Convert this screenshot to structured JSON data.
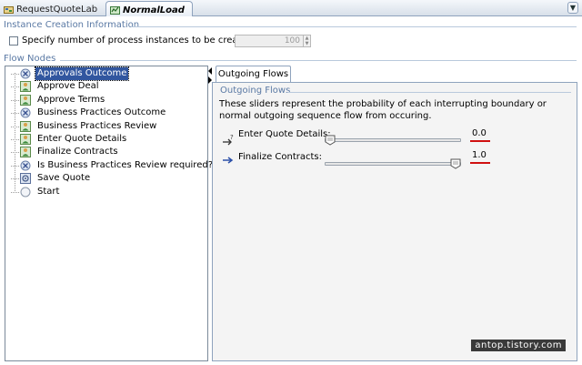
{
  "editor_tabs": [
    {
      "label": "RequestQuoteLab",
      "active": false
    },
    {
      "label": "NormalLoad",
      "active": true
    }
  ],
  "instance_creation": {
    "title": "Instance Creation Information",
    "checkbox_label": "Specify number of process instances to be created",
    "checked": false,
    "count_value": "100"
  },
  "flow_nodes": {
    "title": "Flow Nodes",
    "items": [
      {
        "label": "Approvals Outcome",
        "icon": "gateway-icon",
        "selected": true
      },
      {
        "label": "Approve Deal",
        "icon": "user-task-icon",
        "selected": false
      },
      {
        "label": "Approve Terms",
        "icon": "user-task-icon",
        "selected": false
      },
      {
        "label": "Business Practices Outcome",
        "icon": "gateway-icon",
        "selected": false
      },
      {
        "label": "Business Practices Review",
        "icon": "user-task-icon",
        "selected": false
      },
      {
        "label": "Enter Quote Details",
        "icon": "user-task-icon",
        "selected": false
      },
      {
        "label": "Finalize Contracts",
        "icon": "user-task-icon",
        "selected": false
      },
      {
        "label": "Is Business Practices Review required?",
        "icon": "gateway-icon",
        "selected": false
      },
      {
        "label": "Save Quote",
        "icon": "service-task-icon",
        "selected": false
      },
      {
        "label": "Start",
        "icon": "start-event-icon",
        "selected": false
      }
    ]
  },
  "outgoing": {
    "tab_label": "Outgoing Flows",
    "section_title": "Outgoing Flows",
    "description": "These sliders represent the probability of each interrupting boundary or normal outgoing sequence flow from occuring.",
    "flows": [
      {
        "label": "Enter Quote Details:",
        "value_text": "0.0",
        "probability": 0.0,
        "icon": "conditional-flow-icon"
      },
      {
        "label": "Finalize Contracts:",
        "value_text": "1.0",
        "probability": 1.0,
        "icon": "default-flow-icon"
      }
    ]
  },
  "watermark": "antop.tistory.com",
  "colors": {
    "selection": "#31569f",
    "section_title": "#5a79a4",
    "underline": "#d01010"
  }
}
